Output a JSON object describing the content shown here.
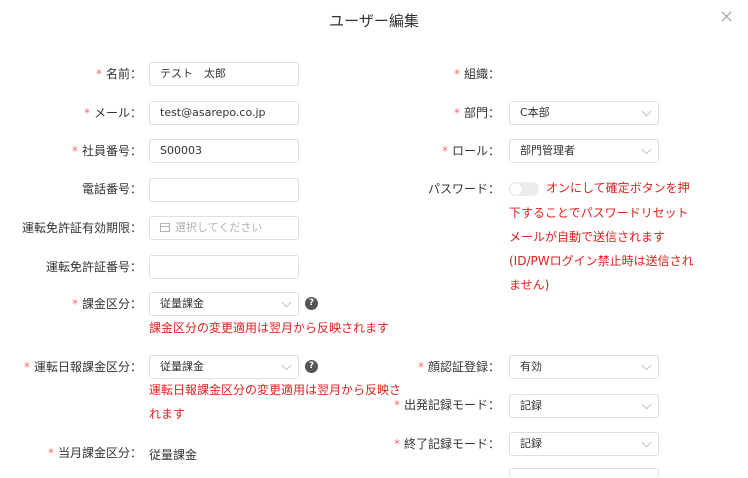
{
  "dialog": {
    "title": "ユーザー編集"
  },
  "req_mark": "*",
  "left": {
    "name": {
      "label": "名前：",
      "value": "テスト　太郎"
    },
    "mail": {
      "label": "メール：",
      "value": "test@asarepo.co.jp"
    },
    "employee_no": {
      "label": "社員番号：",
      "value": "S00003"
    },
    "phone": {
      "label": "電話番号：",
      "value": ""
    },
    "license_expiry": {
      "label": "運転免許証有効期限：",
      "placeholder": "選択してください"
    },
    "license_no": {
      "label": "運転免許証番号：",
      "value": ""
    },
    "billing": {
      "label": "課金区分：",
      "value": "従量課金",
      "note": "課金区分の変更適用は翌月から反映されます"
    },
    "daily_billing": {
      "label": "運転日報課金区分：",
      "value": "従量課金",
      "note_line1": "運転日報課金区分の変更適用は翌月から反映さ",
      "note_line2": "れます"
    },
    "month_billing": {
      "label": "当月課金区分：",
      "value": "従量課金"
    }
  },
  "right": {
    "org": {
      "label": "組織：",
      "value": ""
    },
    "dept": {
      "label": "部門：",
      "value": "C本部"
    },
    "role": {
      "label": "ロール：",
      "value": "部門管理者"
    },
    "password": {
      "label": "パスワード：",
      "toggle_on": false,
      "note_lines": [
        "オンにして確定ボタンを押",
        "下することでパスワードリセット",
        "メールが自動で送信されます",
        "(ID/PWログイン禁止時は送信され",
        "ません)"
      ]
    },
    "face_auth": {
      "label": "顔認証登録：",
      "value": "有効"
    },
    "depart_mode": {
      "label": "出発記録モード：",
      "value": "記録"
    },
    "end_mode": {
      "label": "終了記録モード：",
      "value": "記録"
    }
  },
  "icons": {
    "help": "question-mark-icon",
    "close": "close-icon",
    "calendar": "calendar-icon",
    "chevron": "chevron-down-icon"
  },
  "colors": {
    "required": "#f56c6c",
    "error": "#e02020",
    "border": "#dcdfe6"
  }
}
